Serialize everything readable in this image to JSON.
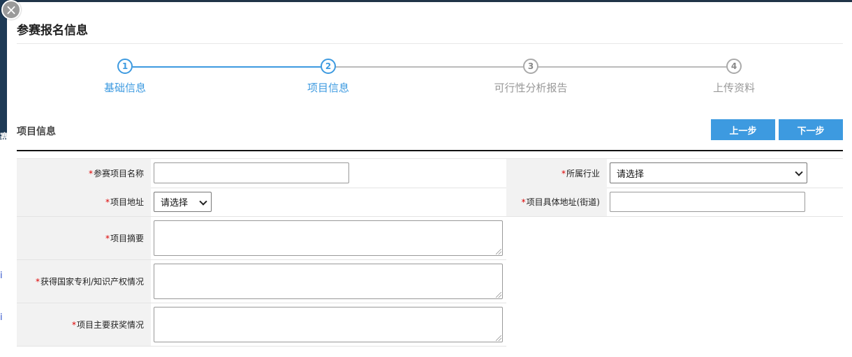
{
  "backdrop": {
    "char": "赛",
    "link1": "i",
    "link2": "i"
  },
  "dialog": {
    "close_symbol": "×",
    "title": "参赛报名信息",
    "steps": [
      {
        "number": "1",
        "label": "基础信息",
        "active": true
      },
      {
        "number": "2",
        "label": "项目信息",
        "active": true
      },
      {
        "number": "3",
        "label": "可行性分析报告",
        "active": false
      },
      {
        "number": "4",
        "label": "上传资料",
        "active": false
      }
    ],
    "section_title": "项目信息",
    "prev_button": "上一步",
    "next_button": "下一步",
    "required_mark": "*",
    "form": {
      "project_name_label": "参赛项目名称",
      "project_name_value": "",
      "industry_label": "所属行业",
      "industry_selected": "请选择",
      "address_label": "项目地址",
      "address_selected": "请选择",
      "street_label": "项目具体地址(街道)",
      "street_value": "",
      "summary_label": "项目摘要",
      "patent_label": "获得国家专利/知识产权情况",
      "awards_label": "项目主要获奖情况"
    }
  },
  "colors": {
    "accent": "#3d9ae0",
    "inactive": "#aaaaaa",
    "required": "#dd0000"
  }
}
